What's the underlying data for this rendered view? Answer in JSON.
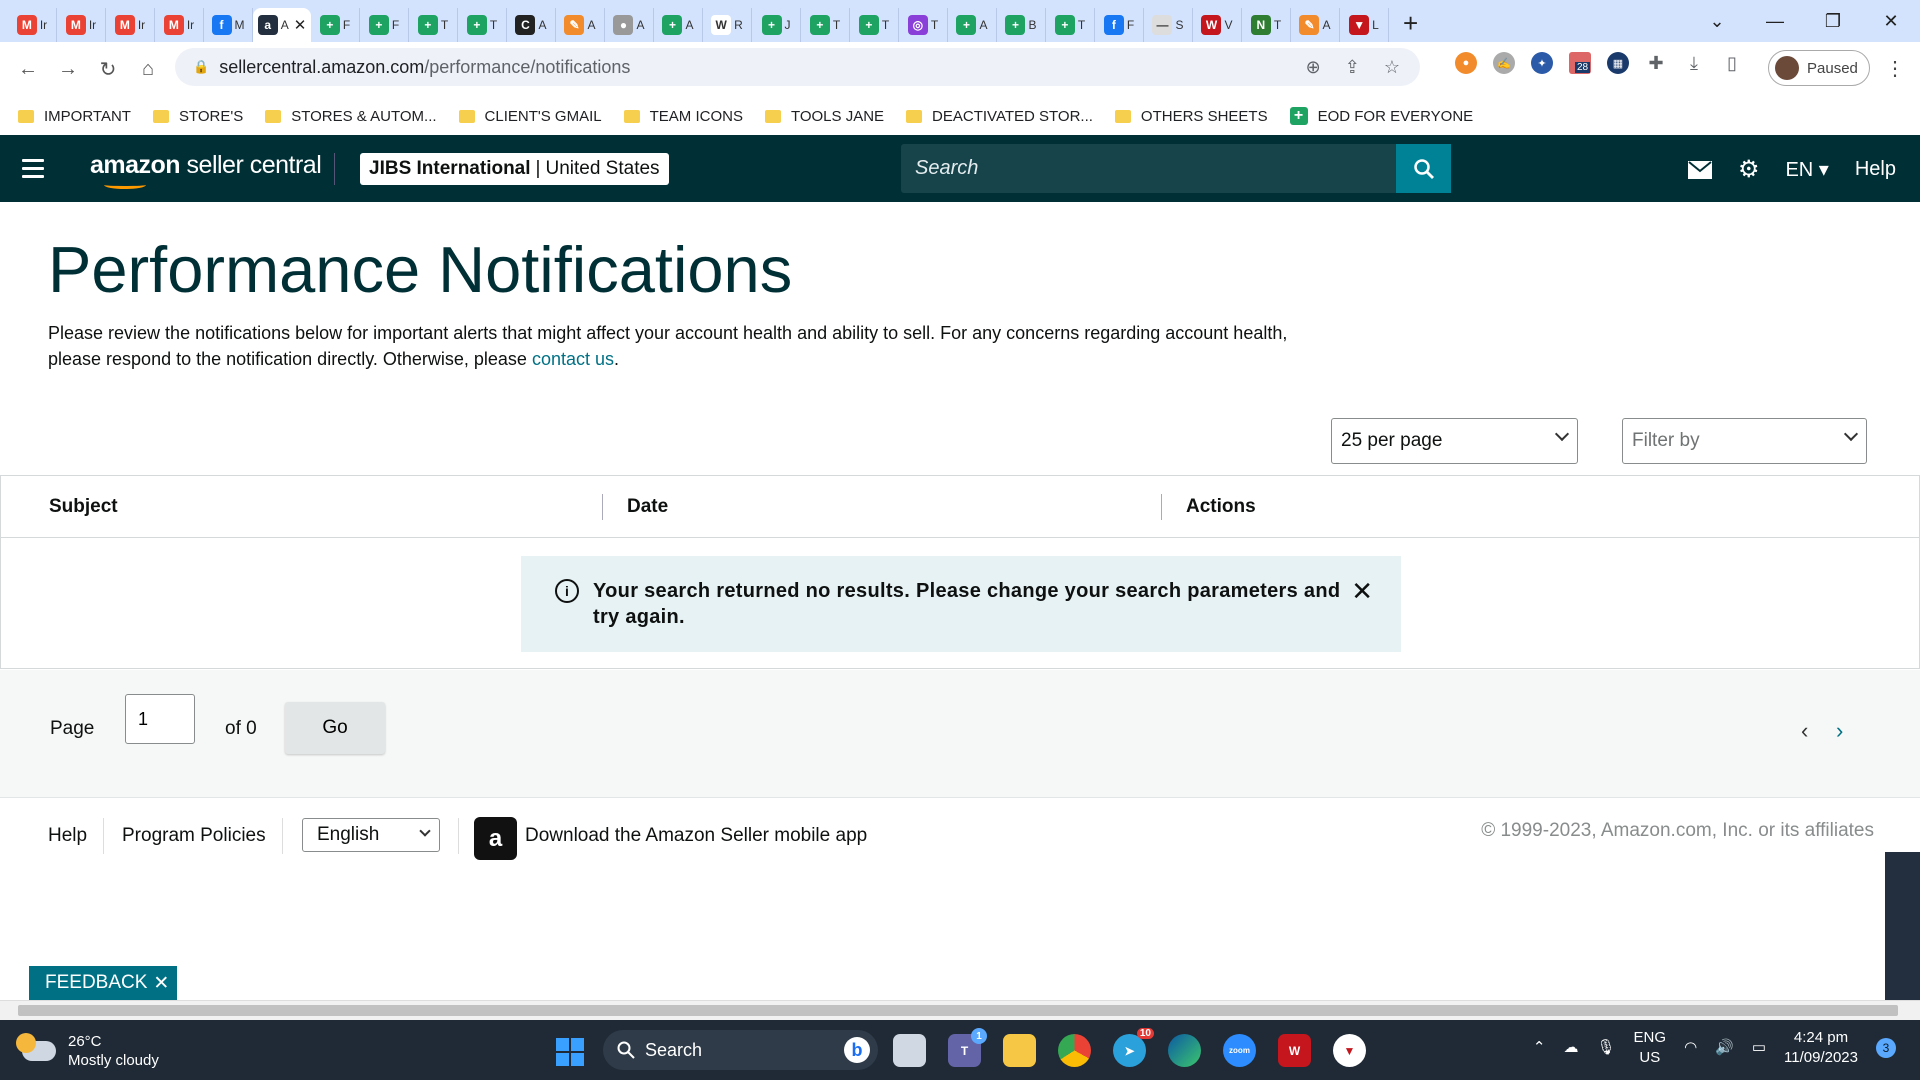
{
  "browser": {
    "tabs": [
      {
        "letter": "M",
        "title": "Ir",
        "color": "#ea4335"
      },
      {
        "letter": "M",
        "title": "Ir",
        "color": "#ea4335"
      },
      {
        "letter": "M",
        "title": "Ir",
        "color": "#ea4335"
      },
      {
        "letter": "M",
        "title": "Ir",
        "color": "#ea4335"
      },
      {
        "letter": "f",
        "title": "M",
        "color": "#1877f2"
      },
      {
        "letter": "a",
        "title": "A",
        "color": "#232f3e",
        "active": true
      },
      {
        "letter": "+",
        "title": "F",
        "color": "#1ea362"
      },
      {
        "letter": "+",
        "title": "F",
        "color": "#1ea362"
      },
      {
        "letter": "+",
        "title": "T",
        "color": "#1ea362"
      },
      {
        "letter": "+",
        "title": "T",
        "color": "#1ea362"
      },
      {
        "letter": "C",
        "title": "A",
        "color": "#222"
      },
      {
        "letter": "✎",
        "title": "A",
        "color": "#f28b2b"
      },
      {
        "letter": "●",
        "title": "A",
        "color": "#999"
      },
      {
        "letter": "+",
        "title": "A",
        "color": "#1ea362"
      },
      {
        "letter": "W",
        "title": "R",
        "color": "#fff"
      },
      {
        "letter": "+",
        "title": "J",
        "color": "#1ea362"
      },
      {
        "letter": "+",
        "title": "T",
        "color": "#1ea362"
      },
      {
        "letter": "+",
        "title": "T",
        "color": "#1ea362"
      },
      {
        "letter": "◎",
        "title": "T",
        "color": "#8b3fd9"
      },
      {
        "letter": "+",
        "title": "A",
        "color": "#1ea362"
      },
      {
        "letter": "+",
        "title": "B",
        "color": "#1ea362"
      },
      {
        "letter": "+",
        "title": "T",
        "color": "#1ea362"
      },
      {
        "letter": "f",
        "title": "F",
        "color": "#1877f2"
      },
      {
        "letter": "—",
        "title": "S",
        "color": "#ddd"
      },
      {
        "letter": "W",
        "title": "V",
        "color": "#c4161c"
      },
      {
        "letter": "N",
        "title": "T",
        "color": "#2e7d32"
      },
      {
        "letter": "✎",
        "title": "A",
        "color": "#f28b2b"
      },
      {
        "letter": "▼",
        "title": "L",
        "color": "#c4161c"
      }
    ],
    "url_host": "sellercentral.amazon.com",
    "url_path": "/performance/notifications",
    "profile_label": "Paused",
    "ext_badge": "28",
    "bookmarks": [
      {
        "label": "IMPORTANT",
        "type": "folder"
      },
      {
        "label": "STORE'S",
        "type": "folder"
      },
      {
        "label": "STORES & AUTOM...",
        "type": "folder"
      },
      {
        "label": "CLIENT'S GMAIL",
        "type": "folder"
      },
      {
        "label": "TEAM ICONS",
        "type": "folder"
      },
      {
        "label": "TOOLS JANE",
        "type": "folder"
      },
      {
        "label": "DEACTIVATED STOR...",
        "type": "folder"
      },
      {
        "label": "OTHERS SHEETS",
        "type": "folder"
      },
      {
        "label": "EOD FOR EVERYONE",
        "type": "sheet"
      }
    ]
  },
  "seller_nav": {
    "logo_bold": "amazon",
    "logo_rest": " seller central",
    "store_name": "JIBS International",
    "store_region": "United States",
    "search_placeholder": "Search",
    "language": "EN",
    "help": "Help"
  },
  "page": {
    "title": "Performance Notifications",
    "intro_text": "Please review the notifications below for important alerts that might affect your account health and ability to sell. For any concerns regarding account health, please respond to the notification directly. Otherwise, please ",
    "intro_link": "contact us",
    "intro_end": ".",
    "per_page": "25 per page",
    "filter_placeholder": "Filter by",
    "columns": [
      "Subject",
      "Date",
      "Actions"
    ],
    "alert_message": "Your search returned no results. Please change your search parameters and try again.",
    "pager": {
      "label": "Page",
      "current": "1",
      "of_text": "of 0",
      "go": "Go"
    }
  },
  "footer": {
    "help": "Help",
    "policies": "Program Policies",
    "language": "English",
    "app_text": "Download the Amazon Seller mobile app",
    "copyright": "© 1999-2023, Amazon.com, Inc. or its affiliates",
    "feedback": "FEEDBACK"
  },
  "taskbar": {
    "temp": "26°C",
    "weather": "Mostly cloudy",
    "search": "Search",
    "lang1": "ENG",
    "lang2": "US",
    "time": "4:24 pm",
    "date": "11/09/2023",
    "notif_count": "3",
    "telegram_badge": "10",
    "teams_badge": "1"
  }
}
